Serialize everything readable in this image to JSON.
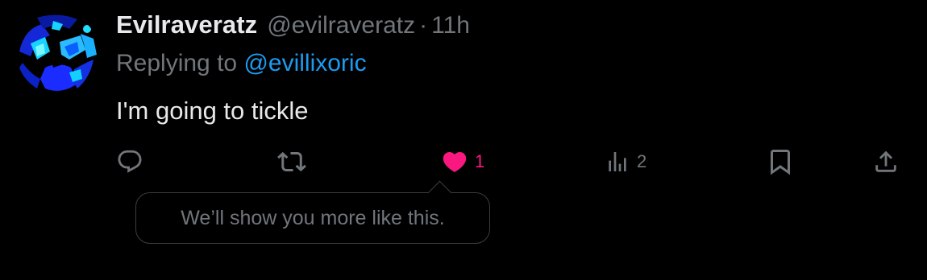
{
  "post": {
    "author": {
      "display_name": "Evilraveratz",
      "handle": "@evilraveratz",
      "separator": "·",
      "time": "11h",
      "avatar_icon": "abstract-blue-avatar"
    },
    "reply": {
      "prefix": "Replying to",
      "mention": "@evillixoric"
    },
    "text": "I'm going to tickle",
    "actions": {
      "reply_icon": "speech-bubble-icon",
      "repost_icon": "repost-arrows-icon",
      "like_icon": "heart-icon",
      "like_count": "1",
      "liked": true,
      "views_icon": "bar-chart-icon",
      "views_count": "2",
      "bookmark_icon": "bookmark-icon",
      "share_icon": "share-upload-icon"
    },
    "tooltip": {
      "text": "We’ll show you more like this."
    }
  },
  "colors": {
    "background": "#000000",
    "primary_text": "#e7e9ea",
    "secondary_text": "#71767b",
    "link": "#1d9bf0",
    "like": "#f91880",
    "tooltip_border": "#3a3d41"
  }
}
